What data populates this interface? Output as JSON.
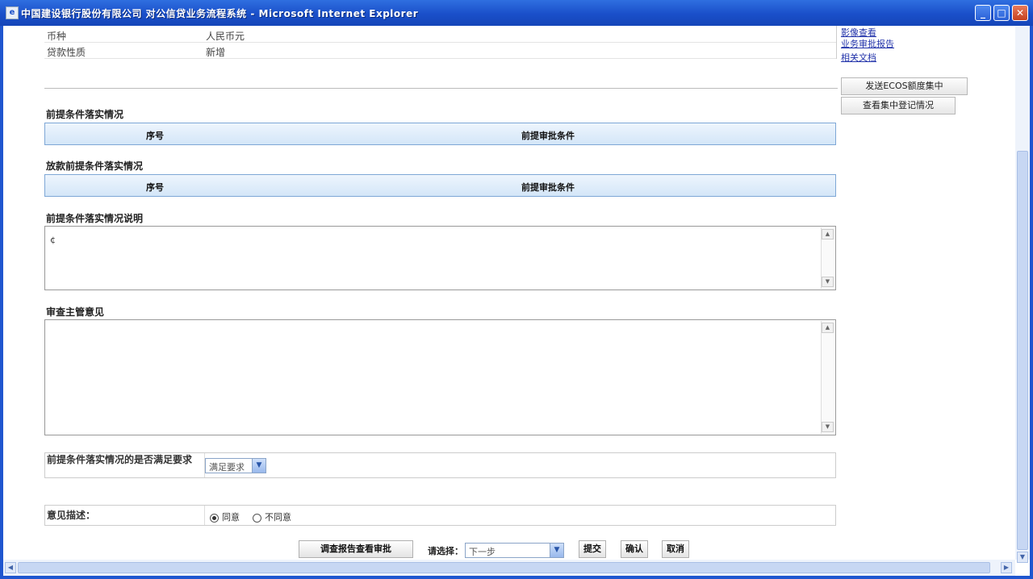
{
  "window": {
    "title": "中国建设银行股份有限公司 对公信贷业务流程系统 - Microsoft Internet Explorer",
    "minimize": "_",
    "maximize": "□",
    "close": "✕"
  },
  "info": {
    "rows": [
      {
        "label": "币种",
        "value": "人民币元"
      },
      {
        "label": "贷款性质",
        "value": "新增"
      }
    ]
  },
  "links": [
    "影像查看",
    "业务审批报告",
    "相关文档"
  ],
  "side_buttons": {
    "send_ecos": "发送ECOS额度集中",
    "view_approval": "查看集中登记情况"
  },
  "sections": {
    "pre_loan_conditions": {
      "label": "前提条件落实情况",
      "col_index": "序号",
      "col_condition": "前提审批条件"
    },
    "loan_conditions": {
      "label": "放款前提条件落实情况",
      "col_index": "序号",
      "col_condition": "前提审批条件"
    },
    "condition_notes": {
      "label": "前提条件落实情况说明",
      "content": "¢"
    },
    "officer_opinion": {
      "label": "审查主管意见",
      "content": ""
    },
    "other_conditions": {
      "label": "前提条件落实情况的是否满足要求",
      "select_value": "满足要求"
    },
    "opinion": {
      "label": "意见描述：",
      "option_agree": "同意",
      "option_disagree": "不同意"
    }
  },
  "footer": {
    "view_report_button": "调查报告查看审批",
    "select_label": "请选择：",
    "select_value": "下一步",
    "submit_button": "提交",
    "confirm_button": "确认",
    "cancel_button": "取消"
  },
  "scroll": {
    "up": "▲",
    "down": "▼",
    "left": "◀",
    "right": "▶"
  }
}
